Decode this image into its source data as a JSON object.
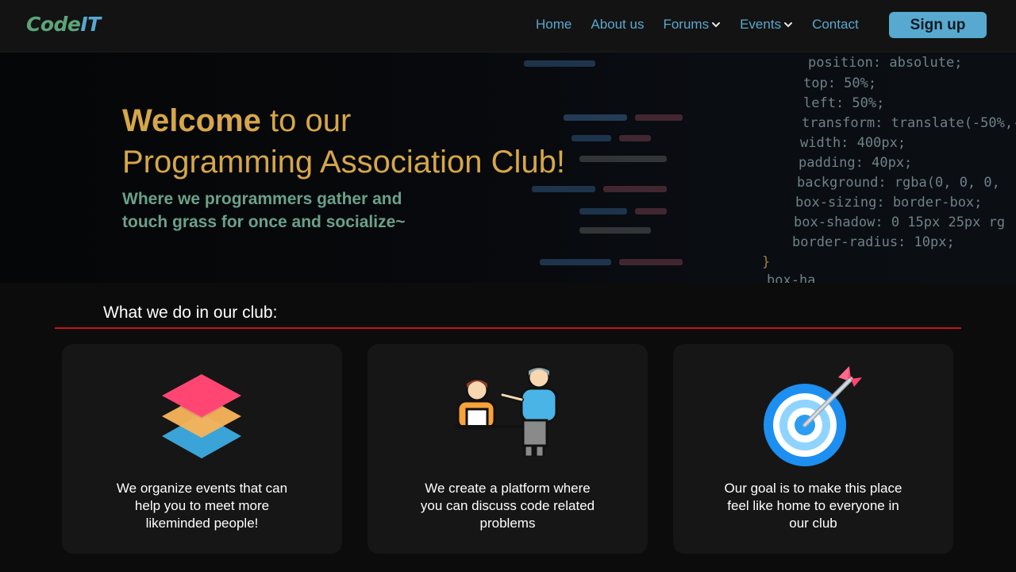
{
  "nav": {
    "logo_part1": "Code",
    "logo_part2": "IT",
    "links": [
      {
        "label": "Home",
        "dropdown": false
      },
      {
        "label": "About us",
        "dropdown": false
      },
      {
        "label": "Forums",
        "dropdown": true
      },
      {
        "label": "Events",
        "dropdown": true
      },
      {
        "label": "Contact",
        "dropdown": false
      }
    ],
    "signup_label": "Sign up"
  },
  "hero": {
    "title_strong": "Welcome",
    "title_rest": " to our",
    "title_line2": "Programming Association Club!",
    "subtitle_line1": "Where we programmers gather and",
    "subtitle_line2": "touch grass for once and socialize~"
  },
  "section": {
    "heading": "What we do in our club:"
  },
  "cards": [
    {
      "icon": "layers-icon",
      "text": "We organize events that can help you to meet more likeminded people!"
    },
    {
      "icon": "presenter-icon",
      "text": "We create a platform where you can discuss code related problems"
    },
    {
      "icon": "target-icon",
      "text": "Our goal is to make this place feel like home to everyone in our club"
    }
  ],
  "code_background": [
    "position: absolute;",
    "top: 50%;",
    "left: 50%;",
    "transform: translate(-50%,-",
    "width: 400px;",
    "padding: 40px;",
    "background: rgba(0, 0, 0,",
    "box-sizing: border-box;",
    "box-shadow: 0 15px 25px rg",
    "border-radius: 10px;",
    "}",
    "box-ha"
  ],
  "colors": {
    "accent": "#57a9cf",
    "title": "#d6a649",
    "subtitle": "#6aa18a",
    "divider": "#c81414"
  }
}
